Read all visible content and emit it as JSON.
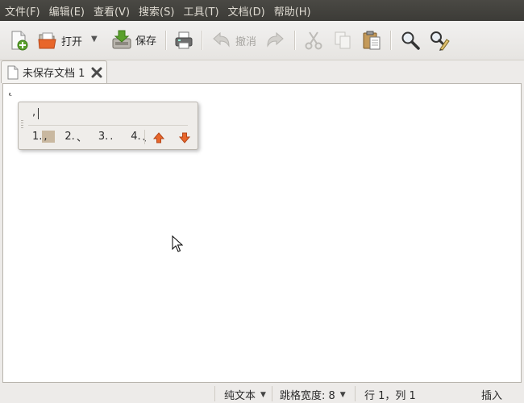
{
  "menubar": {
    "items": [
      "文件(F)",
      "编辑(E)",
      "查看(V)",
      "搜索(S)",
      "工具(T)",
      "文档(D)",
      "帮助(H)"
    ]
  },
  "toolbar": {
    "new_icon": "new-document-icon",
    "open_label": "打开",
    "open_dropdown": "▼",
    "save_label": "保存",
    "print_icon": "print-icon",
    "undo_label": "撤消",
    "redo_icon": "redo-icon",
    "cut_icon": "cut-icon",
    "copy_icon": "copy-icon",
    "paste_icon": "paste-icon",
    "find_icon": "search-icon",
    "replace_icon": "find-replace-icon"
  },
  "tab": {
    "title": "未保存文档 1",
    "close_icon": "close-icon"
  },
  "editor": {
    "text": ","
  },
  "ime": {
    "preedit": ",",
    "candidates": [
      {
        "index": "1.",
        "text": ",",
        "selected": true
      },
      {
        "index": "2.",
        "text": "、"
      },
      {
        "index": "3.",
        "text": "."
      },
      {
        "index": "4.",
        "text": "、"
      }
    ],
    "prev_page_icon": "arrow-up-icon",
    "next_page_icon": "arrow-down-icon"
  },
  "statusbar": {
    "language": "纯文本",
    "tab_width": "跳格宽度: 8",
    "position": "行 1，列 1",
    "mode": "插入",
    "dropdown": "▼"
  },
  "colors": {
    "menubar_bg": "#3c3b37",
    "menubar_text": "#dfdbd2",
    "window_bg": "#edebe9",
    "candidate_highlight": "#c9b8a0",
    "arrow_orange": "#e8662a"
  }
}
